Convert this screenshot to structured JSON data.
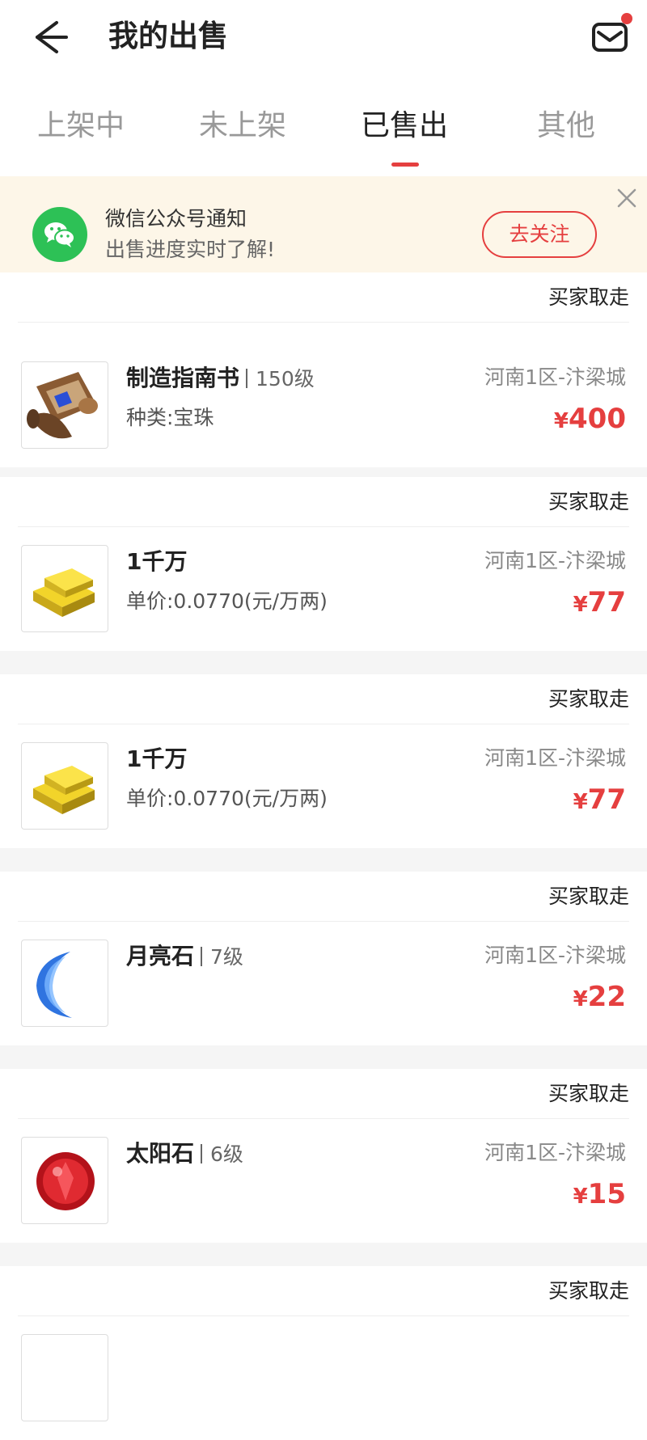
{
  "header": {
    "title": "我的出售"
  },
  "tabs": [
    {
      "label": "上架中"
    },
    {
      "label": "未上架"
    },
    {
      "label": "已售出"
    },
    {
      "label": "其他"
    }
  ],
  "banner": {
    "title": "微信公众号通知",
    "subtitle": "出售进度实时了解!",
    "follow_label": "去关注"
  },
  "orders": [
    {
      "status": "买家取走",
      "name": "制造指南书",
      "level": "150级",
      "sub": "种类:宝珠",
      "server": "河南1区-汴梁城",
      "currency": "¥",
      "price": "400",
      "icon": "scroll-icon"
    },
    {
      "status": "买家取走",
      "name": "1千万",
      "level": "",
      "sub": "单价:0.0770(元/万两)",
      "server": "河南1区-汴梁城",
      "currency": "¥",
      "price": "77",
      "icon": "gold-bars-icon"
    },
    {
      "status": "买家取走",
      "name": "1千万",
      "level": "",
      "sub": "单价:0.0770(元/万两)",
      "server": "河南1区-汴梁城",
      "currency": "¥",
      "price": "77",
      "icon": "gold-bars-icon"
    },
    {
      "status": "买家取走",
      "name": "月亮石",
      "level": "7级",
      "sub": "",
      "server": "河南1区-汴梁城",
      "currency": "¥",
      "price": "22",
      "icon": "moonstone-icon"
    },
    {
      "status": "买家取走",
      "name": "太阳石",
      "level": "6级",
      "sub": "",
      "server": "河南1区-汴梁城",
      "currency": "¥",
      "price": "15",
      "icon": "sunstone-icon"
    },
    {
      "status": "买家取走"
    }
  ],
  "colors": {
    "accent": "#e53f3f",
    "banner_bg": "#fdf6e8",
    "wechat": "#2dc156"
  }
}
